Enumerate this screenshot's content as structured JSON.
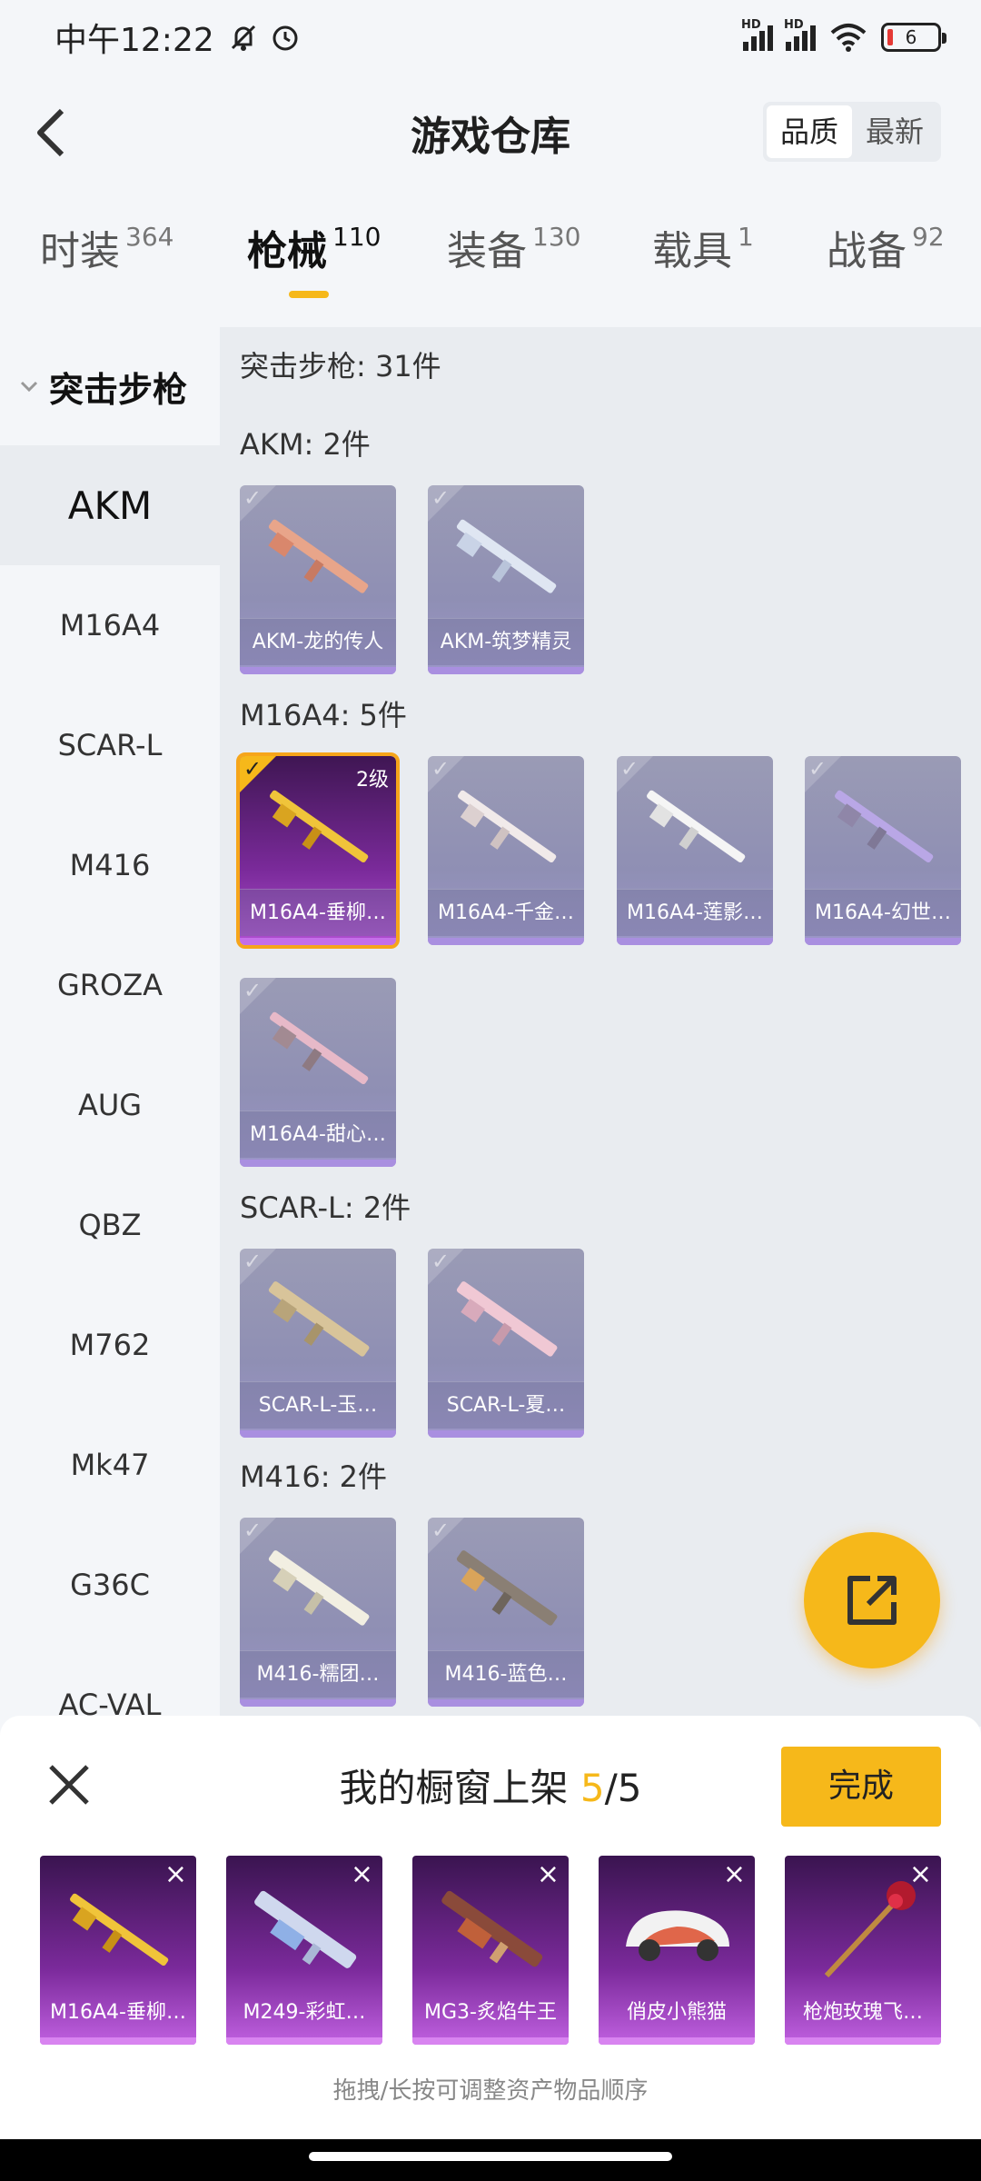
{
  "status": {
    "time": "中午12:22",
    "battery": "6",
    "hd1": "HD",
    "hd2": "HD"
  },
  "header": {
    "title": "游戏仓库",
    "sort_quality": "品质",
    "sort_newest": "最新"
  },
  "tabs": [
    {
      "label": "时装",
      "count": "364"
    },
    {
      "label": "枪械",
      "count": "110"
    },
    {
      "label": "装备",
      "count": "130"
    },
    {
      "label": "载具",
      "count": "1"
    },
    {
      "label": "战备",
      "count": "92"
    }
  ],
  "sidebar": {
    "group": "突击步枪",
    "items": [
      "AKM",
      "M16A4",
      "SCAR-L",
      "M416",
      "GROZA",
      "AUG",
      "QBZ",
      "M762",
      "Mk47",
      "G36C",
      "AC-VAL"
    ]
  },
  "content": {
    "summary": "突击步枪: 31件",
    "sections": [
      {
        "title": "AKM: 2件",
        "items": [
          "AKM-龙的传人",
          "AKM-筑梦精灵"
        ]
      },
      {
        "title": "M16A4: 5件",
        "items": [
          "M16A4-垂柳…",
          "M16A4-千金…",
          "M16A4-莲影…",
          "M16A4-幻世…",
          "M16A4-甜心…"
        ],
        "selected_level": "2级"
      },
      {
        "title": "SCAR-L: 2件",
        "items": [
          "SCAR-L-玉…",
          "SCAR-L-夏…"
        ]
      },
      {
        "title": "M416: 2件",
        "items": [
          "M416-糯团…",
          "M416-蓝色…"
        ]
      }
    ]
  },
  "showcase": {
    "title_prefix": "我的橱窗上架 ",
    "count": "5",
    "total": "/5",
    "done": "完成",
    "slots": [
      "M16A4-垂柳…",
      "M249-彩虹…",
      "MG3-炙焰牛王",
      "俏皮小熊猫",
      "枪炮玫瑰飞…"
    ],
    "hint": "拖拽/长按可调整资产物品顺序"
  },
  "colors": {
    "accent": "#f6b81a",
    "card_purple": "#9a9bb5",
    "legendary": "#7a2a9a"
  }
}
